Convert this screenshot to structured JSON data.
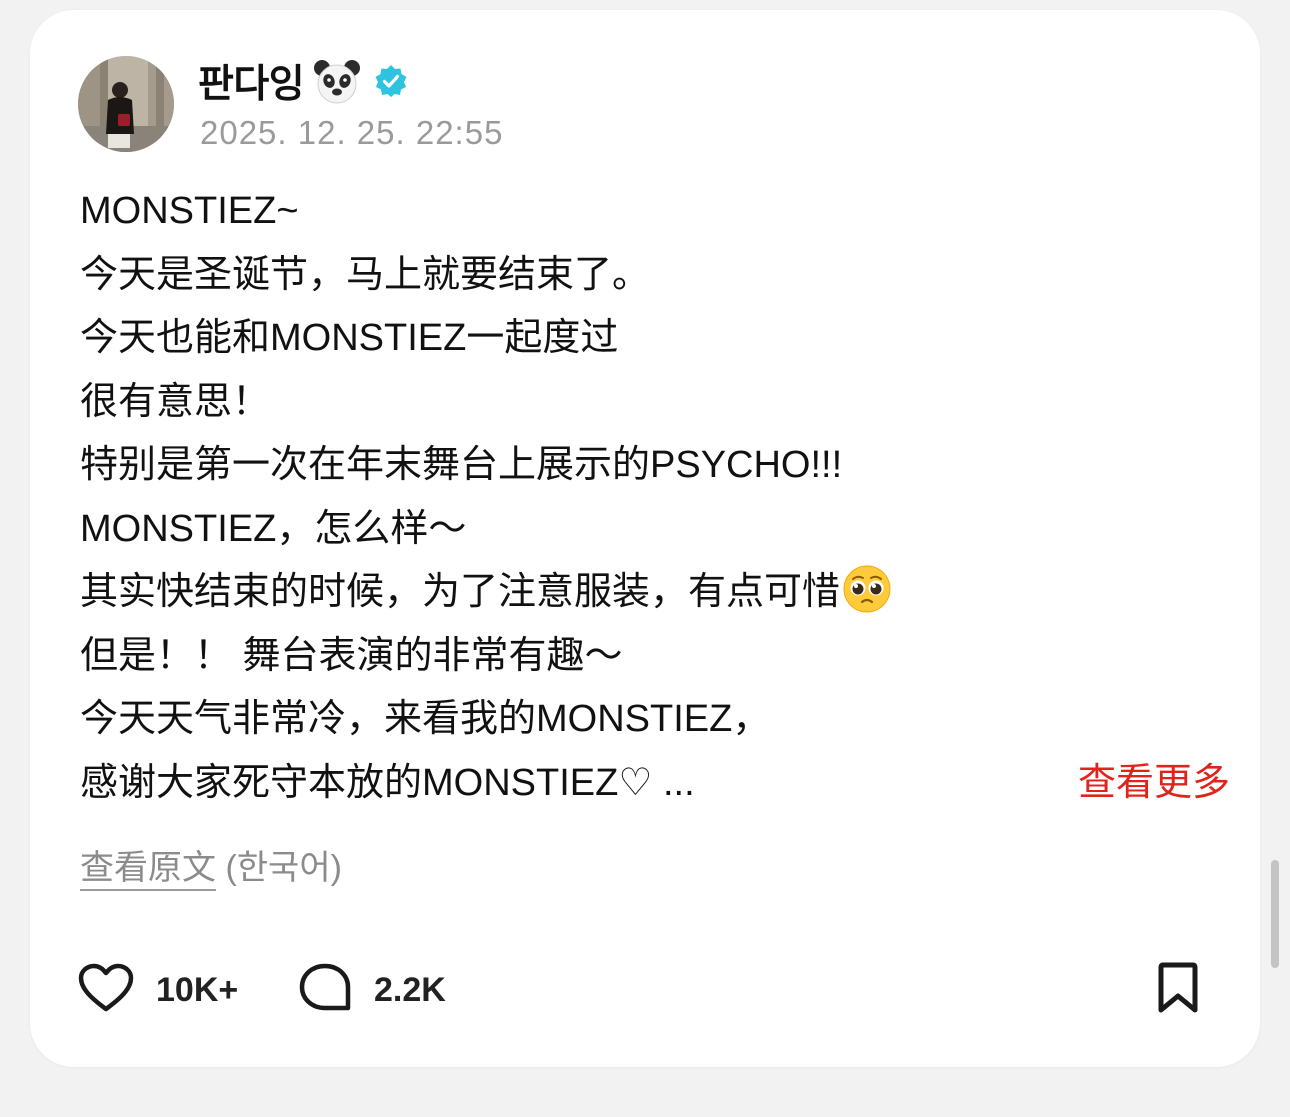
{
  "post": {
    "username": "판다잉",
    "timestamp": "2025. 12. 25. 22:55",
    "lines": [
      "MONSTIEZ~",
      "今天是圣诞节，马上就要结束了。",
      "今天也能和MONSTIEZ一起度过",
      "很有意思！",
      "特别是第一次在年末舞台上展示的PSYCHO!!!",
      "MONSTIEZ，怎么样～",
      "其实快结束的时候，为了注意服装，有点可惜",
      "但是！！ 舞台表演的非常有趣～",
      "今天天气非常冷，来看我的MONSTIEZ，",
      "感谢大家死守本放的MONSTIEZ♡ ..."
    ],
    "see_more": "查看更多",
    "translate_link": "查看原文",
    "translate_lang": " (한국어)",
    "likes": "10K+",
    "comments": "2.2K"
  },
  "icons": {
    "name_badge": "panda-icon",
    "verified": "verified-badge-icon",
    "inline_emoji": "pleading-face-icon",
    "like": "heart-icon",
    "comment": "comment-bubble-icon",
    "bookmark": "bookmark-icon"
  },
  "colors": {
    "see_more": "#e0241b",
    "verified": "#2ec4e0",
    "timestamp": "#9a9a9a",
    "card_bg": "#ffffff",
    "page_bg": "#f2f2f2"
  }
}
